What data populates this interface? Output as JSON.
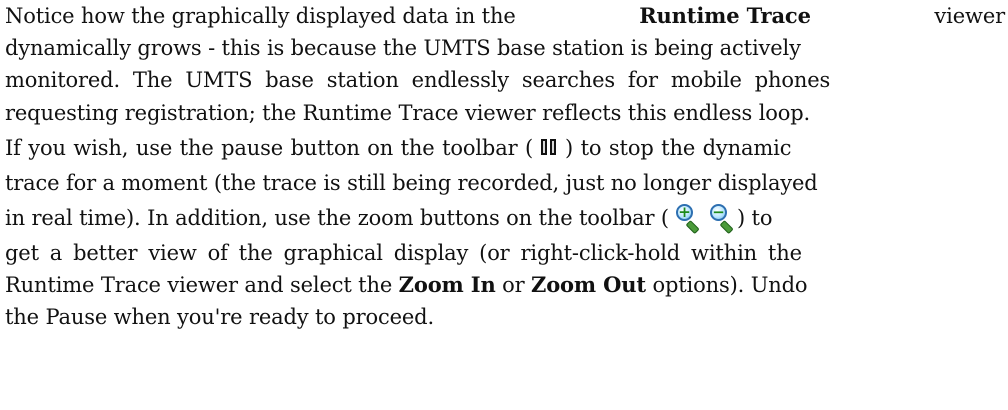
{
  "paragraph": {
    "line1": [
      "Notice how the graphically displayed data in the ",
      "Runtime Trace",
      " viewer"
    ],
    "line2": "dynamically grows - this is because the UMTS base station is being actively",
    "line3": "monitored. The UMTS base station endlessly searches for mobile phones",
    "line4": "requesting registration; the Runtime Trace viewer reflects this endless loop.",
    "line5": [
      "If you wish, use the pause button on the toolbar (",
      ") to stop the dynamic"
    ],
    "line6": "trace for a moment (the trace is still being recorded, just no longer displayed",
    "line7": [
      "in real time). In addition, use the zoom buttons on the toolbar (",
      ") to"
    ],
    "line8": "get a better view of the graphical display (or right-click-hold within the",
    "line9": [
      "Runtime Trace viewer and select the ",
      "Zoom In",
      " or ",
      "Zoom Out",
      " options). Undo"
    ],
    "line10": "the Pause when you're ready to proceed."
  },
  "icons": {
    "pause": "pause-icon",
    "zoom_in": "zoom-in-icon",
    "zoom_out": "zoom-out-icon",
    "zoom_in_sign": "+",
    "zoom_out_sign": "−"
  }
}
